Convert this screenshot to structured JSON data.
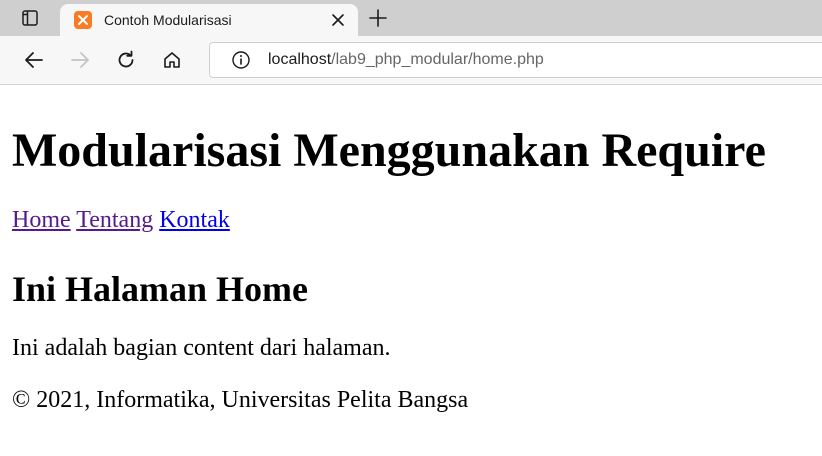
{
  "browser": {
    "tab": {
      "title": "Contoh Modularisasi"
    },
    "address": {
      "host": "localhost",
      "path": "/lab9_php_modular/home.php"
    },
    "accent": "#fb7a24"
  },
  "page": {
    "title": "Modularisasi Menggunakan Require",
    "nav": [
      {
        "label": "Home"
      },
      {
        "label": "Tentang"
      },
      {
        "label": "Kontak"
      }
    ],
    "heading": "Ini Halaman Home",
    "content": "Ini adalah bagian content dari halaman.",
    "footer": "© 2021, Informatika, Universitas Pelita Bangsa"
  }
}
